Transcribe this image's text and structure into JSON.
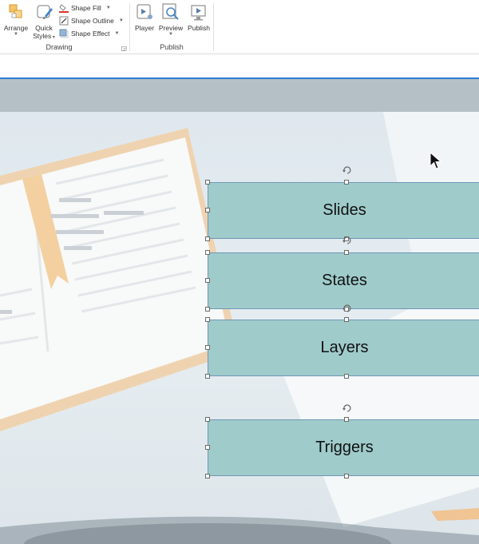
{
  "ribbon": {
    "drawing_group": {
      "label": "Drawing",
      "arrange_label": "Arrange",
      "quick_styles_line1": "Quick",
      "quick_styles_line2": "Styles",
      "shape_fill_label": "Shape Fill",
      "shape_outline_label": "Shape Outline",
      "shape_effect_label": "Shape Effect"
    },
    "publish_group": {
      "label": "Publish",
      "player_label": "Player",
      "preview_label": "Preview",
      "publish_label": "Publish"
    }
  },
  "slide": {
    "shapes": [
      {
        "label": "Slides"
      },
      {
        "label": "States"
      },
      {
        "label": "Layers"
      },
      {
        "label": "Triggers"
      }
    ]
  },
  "colors": {
    "shape_fill": "#a0cbcb",
    "shape_border": "#6d97b6",
    "selection_accent": "#2b7cd3"
  },
  "icons": [
    "arrange-icon",
    "quick-styles-icon",
    "shape-fill-icon",
    "shape-outline-icon",
    "shape-effect-icon",
    "player-icon",
    "preview-icon",
    "publish-icon",
    "rotate-handle-icon",
    "mouse-cursor-icon"
  ]
}
